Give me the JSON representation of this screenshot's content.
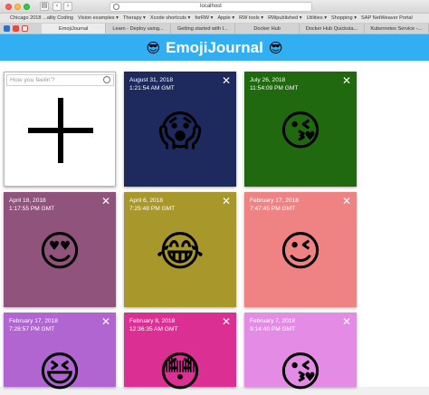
{
  "browser": {
    "address": "localhost",
    "bookmarks": [
      "Chicago 2018 ...ality Coding",
      "Vision examples ▾",
      "Therapy ▾",
      "Xcode shortcuts ▾",
      "forRW ▾",
      "Apple ▾",
      "RW tools ▾",
      "RWpublished ▾",
      "Utilities ▾",
      "Shopping ▾",
      "SAP NetWeaver Portal"
    ],
    "tabs": [
      "EmojiJournal",
      "Learn - Deploy using...",
      "Getting started with I...",
      "Docker Hub",
      "Docker Hub Quicksta...",
      "Kubernetes Service -..."
    ]
  },
  "app": {
    "title": "EmojiJournal",
    "header_emoji": "😎",
    "new_entry": {
      "placeholder": "How you feelin'?"
    },
    "close_glyph": "✕",
    "entries": [
      {
        "date": "August 31, 2018",
        "time": "1:21:54 AM GMT",
        "emoji": "😱",
        "color": "#1e2a5e"
      },
      {
        "date": "July 26, 2018",
        "time": "11:54:09 PM GMT",
        "emoji": "😘",
        "color": "#20690f"
      },
      {
        "date": "April 18, 2018",
        "time": "1:17:55 PM GMT",
        "emoji": "😍",
        "color": "#8f537c"
      },
      {
        "date": "April 6, 2018",
        "time": "7:25:48 PM GMT",
        "emoji": "😂",
        "color": "#a8972b"
      },
      {
        "date": "February 17, 2018",
        "time": "7:47:45 PM GMT",
        "emoji": "😉",
        "color": "#ef8383"
      },
      {
        "date": "February 17, 2018",
        "time": "7:28:57 PM GMT",
        "emoji": "😆",
        "color": "#b065d1"
      },
      {
        "date": "February 8, 2018",
        "time": "12:36:35 AM GMT",
        "emoji": "😳",
        "color": "#dc2f93"
      },
      {
        "date": "February 7, 2018",
        "time": "9:14:40 PM GMT",
        "emoji": "😘",
        "color": "#e48ce5"
      }
    ]
  }
}
